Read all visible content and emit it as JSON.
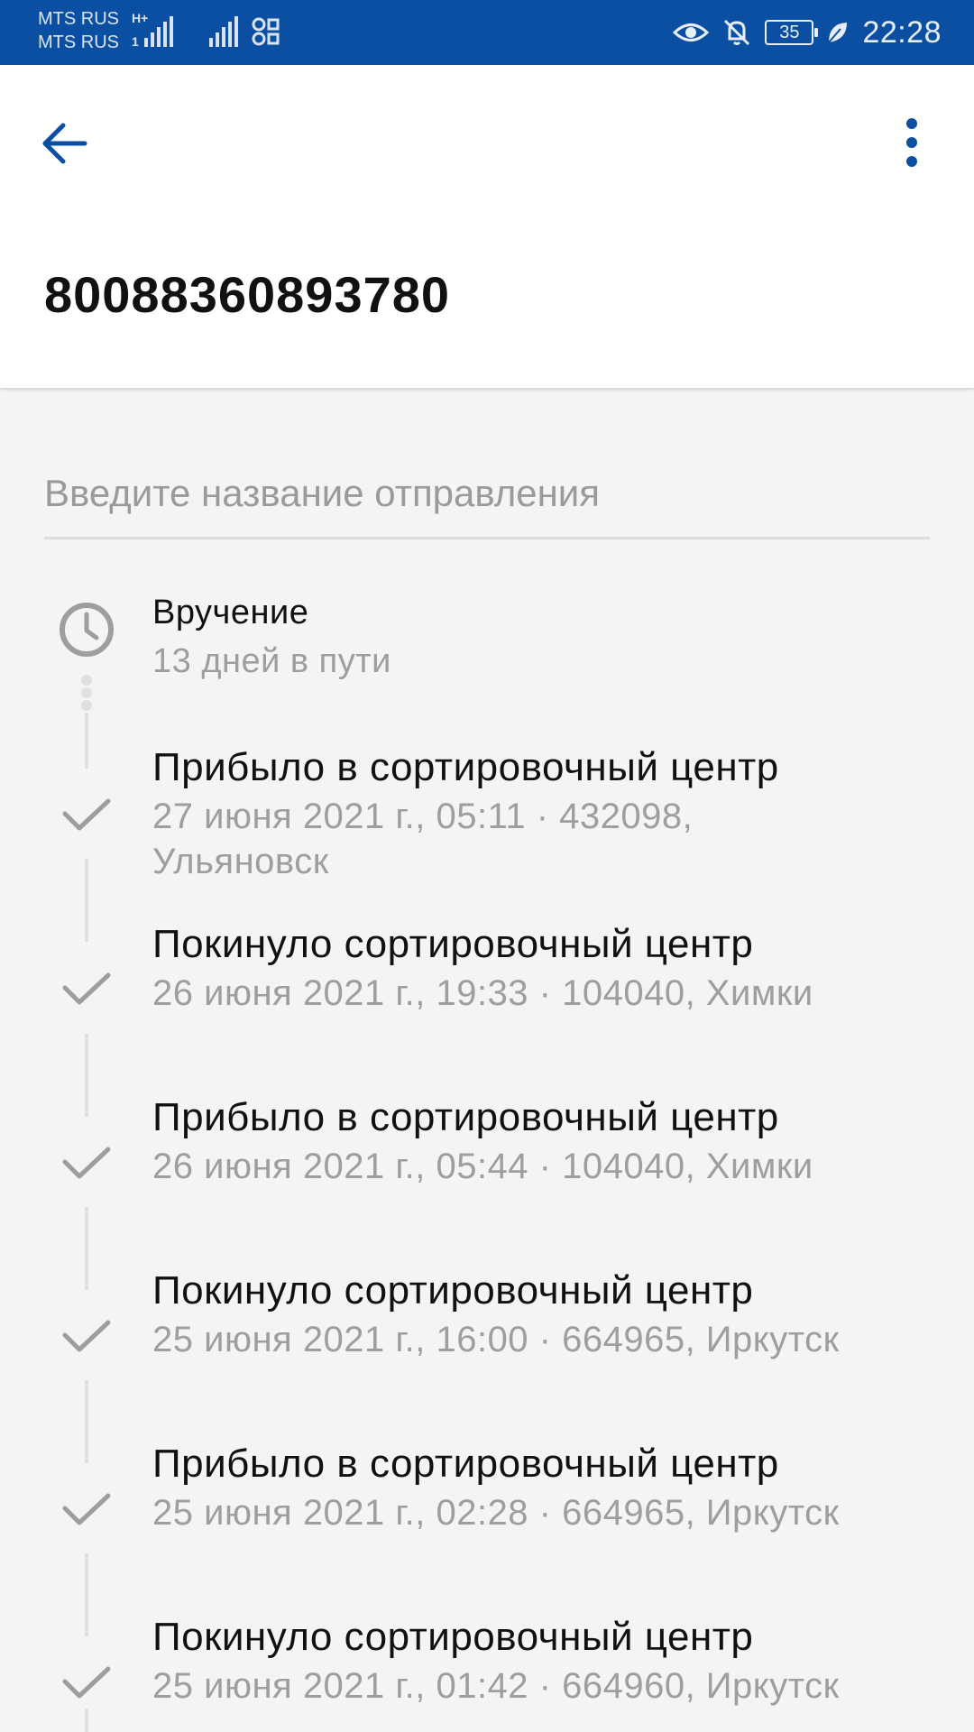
{
  "status_bar": {
    "carrier_1": "MTS RUS",
    "carrier_2": "MTS RUS",
    "network_1": "H+",
    "network_2": "1",
    "battery_level": "35",
    "time": "22:28",
    "background_color": "#0b4fa3"
  },
  "header": {
    "back_icon": "arrow-left-icon",
    "more_icon": "more-vertical-icon",
    "tracking_number": "80088360893780",
    "accent_color": "#0b4fa3"
  },
  "name_input": {
    "placeholder": "Введите название отправления",
    "value": ""
  },
  "delivery": {
    "icon": "clock-icon",
    "title": "Вручение",
    "subtitle": "13 дней в пути"
  },
  "events": [
    {
      "icon": "check-icon",
      "title": "Прибыло в сортировочный центр",
      "detail": "27 июня 2021 г., 05:11 · 432098, Ульяновск"
    },
    {
      "icon": "check-icon",
      "title": "Покинуло сортировочный центр",
      "detail": "26 июня 2021 г., 19:33 · 104040, Химки"
    },
    {
      "icon": "check-icon",
      "title": "Прибыло в сортировочный центр",
      "detail": "26 июня 2021 г., 05:44 · 104040, Химки"
    },
    {
      "icon": "check-icon",
      "title": "Покинуло сортировочный центр",
      "detail": "25 июня 2021 г., 16:00 · 664965, Иркутск"
    },
    {
      "icon": "check-icon",
      "title": "Прибыло в сортировочный центр",
      "detail": "25 июня 2021 г., 02:28 · 664965, Иркутск"
    },
    {
      "icon": "check-icon",
      "title": "Покинуло сортировочный центр",
      "detail": "25 июня 2021 г., 01:42 · 664960, Иркутск"
    }
  ]
}
